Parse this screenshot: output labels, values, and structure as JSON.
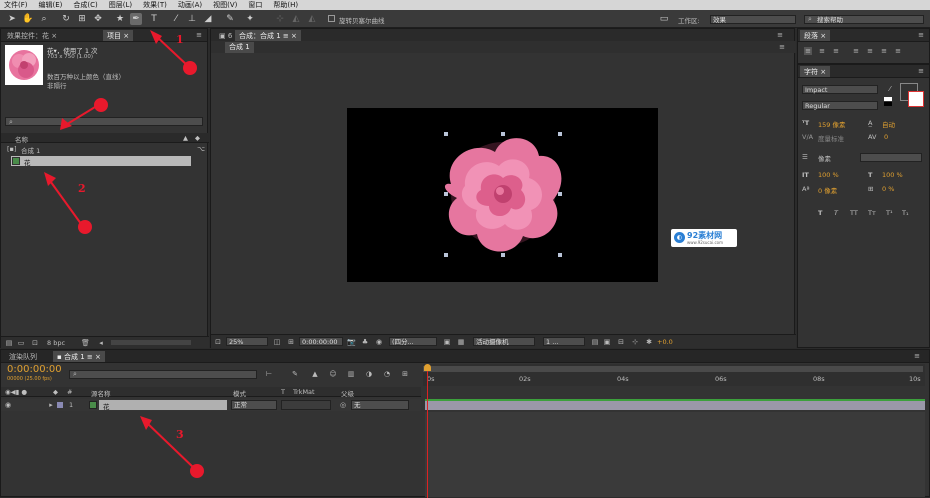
{
  "menu": [
    "文件(F)",
    "编辑(E)",
    "合成(C)",
    "图层(L)",
    "效果(T)",
    "动画(A)",
    "视图(V)",
    "窗口",
    "帮助(H)"
  ],
  "toolbar": {
    "checkbox_label": "旋转贝塞尔曲线",
    "workspace_label": "工作区:",
    "workspace_value": "效果",
    "search_placeholder": "搜索帮助"
  },
  "effects_tab": "效果控件：花",
  "project_tab": "项目",
  "project": {
    "item_name": "花",
    "item_used": "，使用了 1 次",
    "item_size": "703 x 750 (1.00)",
    "item_desc": "数百万种以上颜色（直线）",
    "item_status": "非隔行",
    "column_name": "名称",
    "rows": [
      "合成 1",
      "花"
    ],
    "bpc": "8 bpc"
  },
  "comp": {
    "tab": "合成：合成 1",
    "subtab": "合成 1",
    "zoom": "25%",
    "timecode": "0:00:00:00",
    "resolution": "(四分...",
    "camera": "活动摄像机",
    "views": "1 ...",
    "exposure": "+0.0"
  },
  "watermark": {
    "brand": "92素材网",
    "url": "www.92sucai.com"
  },
  "paragraph_tab": "段落",
  "character": {
    "tab": "字符",
    "font": "Impact",
    "style": "Regular",
    "size": "159 像素",
    "leading": "自动",
    "kerning": "度量标准",
    "tracking": "0",
    "stroke_unit": "像素",
    "v_scale": "100 %",
    "h_scale": "100 %",
    "baseline": "0 像素",
    "tsume": "0 %",
    "styles": [
      "T",
      "T",
      "TT",
      "Tт",
      "T¹",
      "T₁"
    ],
    "fill_color": "#ffffff",
    "stroke_color": "#000000"
  },
  "timeline": {
    "tabs": [
      "渲染队列",
      "合成 1"
    ],
    "timecode": "0:00:00:00",
    "fps": "00000 (25.00 fps)",
    "search_placeholder": "",
    "cols": [
      "#",
      "源名称",
      "模式",
      "T",
      "TrkMat",
      "父级"
    ],
    "layer_num": "1",
    "layer_name": "花",
    "layer_mode": "正常",
    "layer_parent": "无",
    "ruler": [
      "0s",
      "02s",
      "04s",
      "06s",
      "08s",
      "10s"
    ]
  },
  "annotations": [
    "1",
    "2",
    "3"
  ],
  "colors": {
    "accent": "#e0a030",
    "marker": "#e8192c",
    "timecode": "#e0a030",
    "layerbar": "#9a98a8"
  }
}
